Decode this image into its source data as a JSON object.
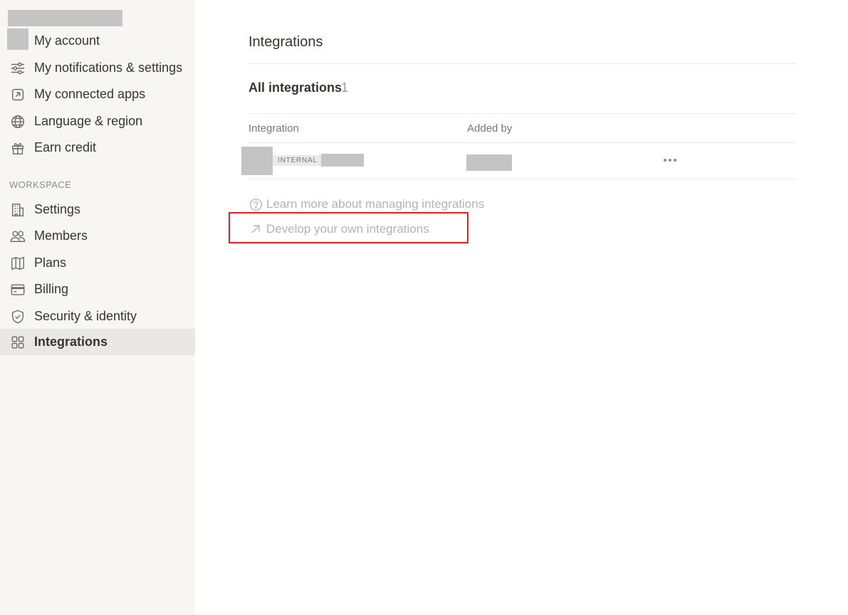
{
  "sidebar": {
    "items": [
      {
        "label": "My account",
        "icon": "avatar"
      },
      {
        "label": "My notifications & settings",
        "icon": "sliders-icon"
      },
      {
        "label": "My connected apps",
        "icon": "external-link-square-icon"
      },
      {
        "label": "Language & region",
        "icon": "globe-icon"
      },
      {
        "label": "Earn credit",
        "icon": "gift-icon"
      }
    ],
    "workspace_label": "WORKSPACE",
    "workspace_items": [
      {
        "label": "Settings",
        "icon": "building-icon"
      },
      {
        "label": "Members",
        "icon": "people-icon"
      },
      {
        "label": "Plans",
        "icon": "map-icon"
      },
      {
        "label": "Billing",
        "icon": "credit-card-icon"
      },
      {
        "label": "Security & identity",
        "icon": "shield-check-icon"
      },
      {
        "label": "Integrations",
        "icon": "grid-icon",
        "active": true
      }
    ]
  },
  "main": {
    "title": "Integrations",
    "section_title": "All integrations",
    "section_count": "1",
    "columns": [
      "Integration",
      "Added by"
    ],
    "rows": [
      {
        "badge": "INTERNAL"
      }
    ],
    "links": [
      {
        "label": "Learn more about managing integrations",
        "icon": "help-circle-icon"
      },
      {
        "label": "Develop your own integrations",
        "icon": "arrow-up-right-icon"
      }
    ]
  },
  "colors": {
    "sidebar_bg": "#f7f6f3",
    "active_item_bg": "#e9e8e4",
    "highlight_border": "#e02020"
  }
}
